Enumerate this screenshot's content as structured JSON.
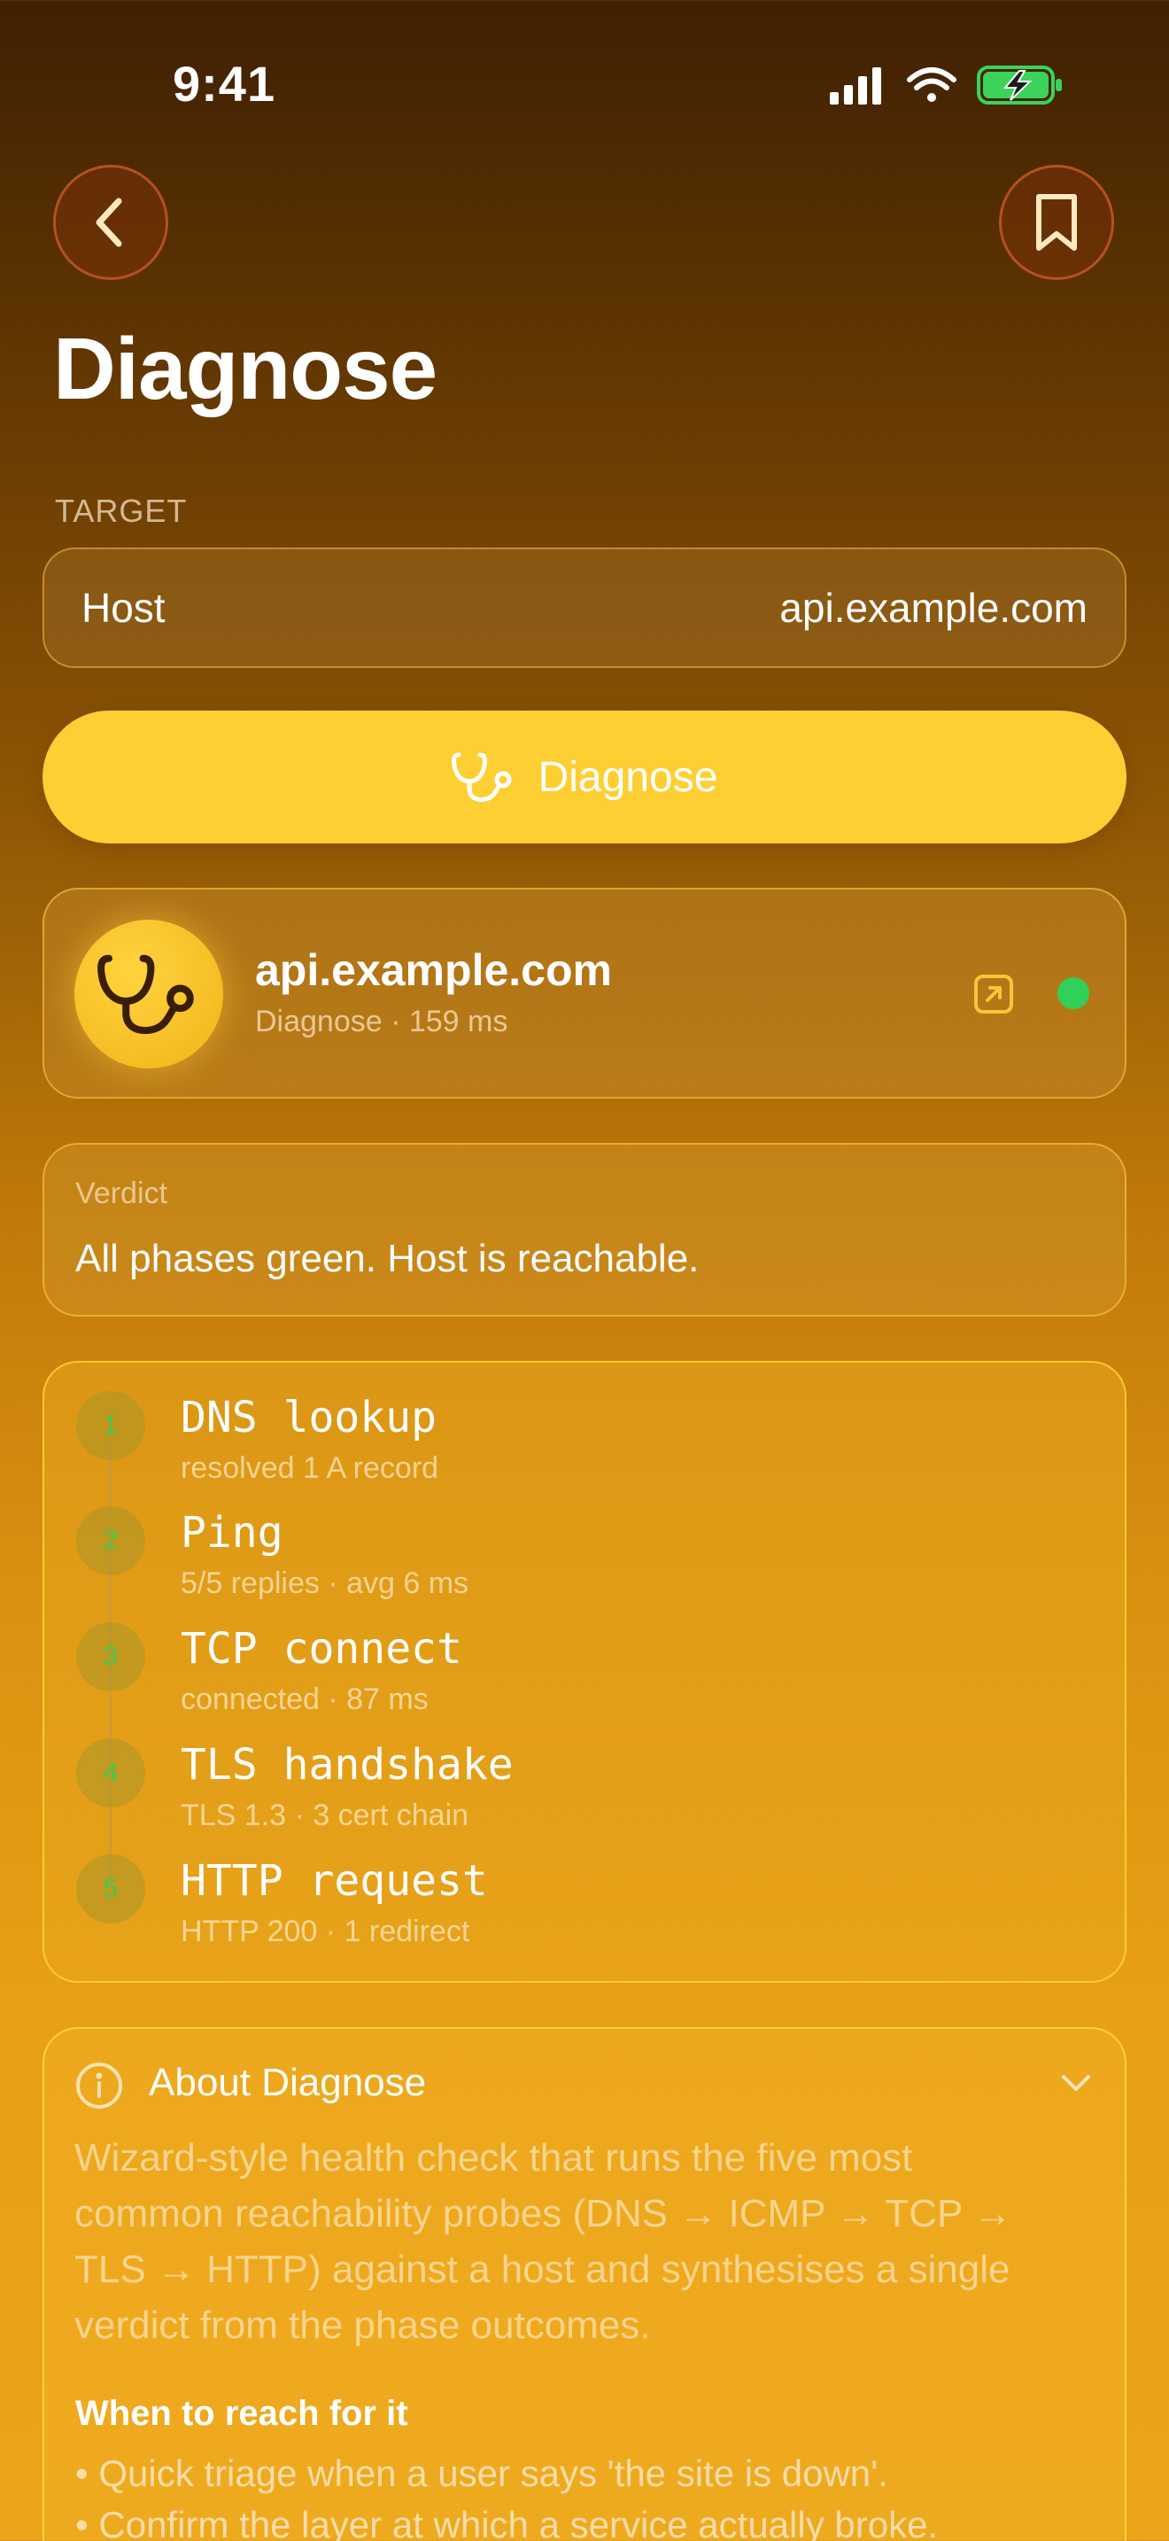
{
  "status_bar": {
    "time": "9:41"
  },
  "header": {
    "title": "Diagnose"
  },
  "target": {
    "section_label": "TARGET",
    "field_label": "Host",
    "field_value": "api.example.com"
  },
  "action": {
    "label": "Diagnose"
  },
  "result": {
    "host": "api.example.com",
    "subtitle": "Diagnose · 159 ms",
    "status_color": "#2fd158"
  },
  "verdict": {
    "label": "Verdict",
    "text": "All phases green. Host is reachable."
  },
  "phases": [
    {
      "num": "1",
      "title": "DNS lookup",
      "detail": "resolved 1 A record"
    },
    {
      "num": "2",
      "title": "Ping",
      "detail": "5/5 replies · avg 6 ms"
    },
    {
      "num": "3",
      "title": "TCP connect",
      "detail": "connected · 87 ms"
    },
    {
      "num": "4",
      "title": "TLS handshake",
      "detail": "TLS 1.3 · 3 cert chain"
    },
    {
      "num": "5",
      "title": "HTTP request",
      "detail": "HTTP 200 · 1 redirect"
    }
  ],
  "about": {
    "title": "About Diagnose",
    "lines": [
      "Wizard-style health check that runs the five most",
      "common reachability probes (DNS → ICMP → TCP →",
      "TLS → HTTP) against a host and synthesises a single",
      "verdict from the phase outcomes."
    ],
    "when_title": "When to reach for it",
    "bullets": [
      "Quick triage when a user says 'the site is down'.",
      "Confirm the layer at which a service actually broke."
    ]
  },
  "colors": {
    "accent": "#fdcf33",
    "success": "#2fd158"
  }
}
